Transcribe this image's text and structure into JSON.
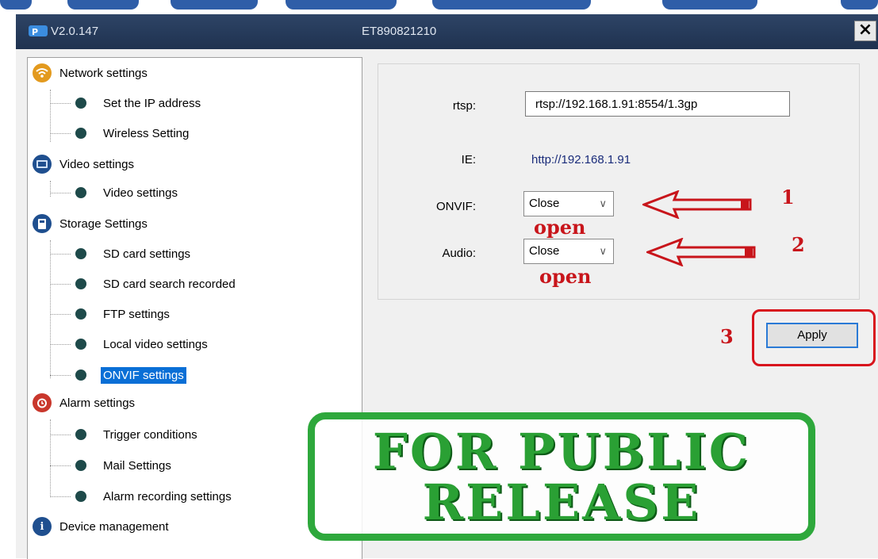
{
  "titlebar": {
    "version": "V2.0.147",
    "device_id": "ET890821210",
    "close_label": "×"
  },
  "tree": {
    "categories": [
      {
        "label": "Network settings",
        "icon": "wifi-icon",
        "color": "#e39a1e",
        "children": [
          "Set the IP address",
          "Wireless Setting"
        ]
      },
      {
        "label": "Video settings",
        "icon": "video-icon",
        "color": "#1f4f8f",
        "children": [
          "Video settings"
        ]
      },
      {
        "label": "Storage Settings",
        "icon": "storage-icon",
        "color": "#1f4f8f",
        "children": [
          "SD card settings",
          "SD card search recorded",
          "FTP settings",
          "Local video settings",
          "ONVIF settings"
        ]
      },
      {
        "label": "Alarm settings",
        "icon": "alarm-clock-icon",
        "color": "#c9372c",
        "children": [
          "Trigger conditions",
          "Mail Settings",
          "Alarm recording settings"
        ]
      },
      {
        "label": "Device management",
        "icon": "info-icon",
        "color": "#1f4f8f",
        "children": []
      }
    ],
    "selected": "ONVIF settings"
  },
  "form": {
    "rtsp_label": "rtsp:",
    "rtsp_value": "rtsp://192.168.1.91:8554/1.3gp",
    "ie_label": "IE:",
    "ie_value": "http://192.168.1.91",
    "onvif_label": "ONVIF:",
    "onvif_value": "Close",
    "audio_label": "Audio:",
    "audio_value": "Close",
    "apply_label": "Apply"
  },
  "annotations": {
    "onvif_note": "open",
    "audio_note": "open",
    "step1": "1",
    "step2": "2",
    "step3": "3",
    "accent_color": "#c8151b"
  },
  "stamp": {
    "line1": "FOR PUBLIC",
    "line2": "RELEASE",
    "color": "#2ea83c"
  }
}
